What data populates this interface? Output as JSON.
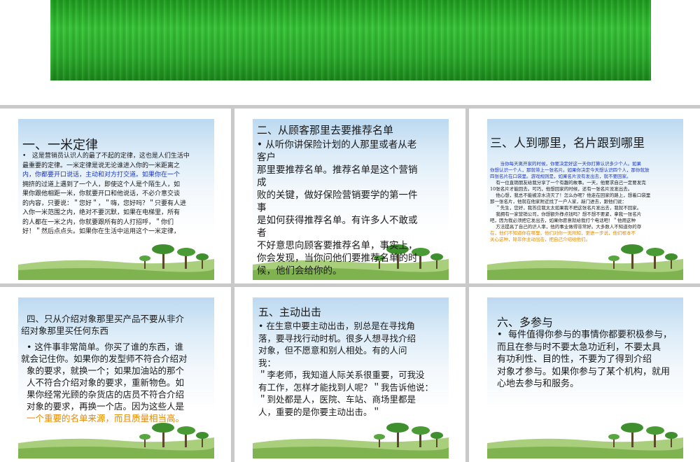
{
  "s1": {
    "title": "一、一米定律",
    "bullet": "•",
    "l1": "这是营销员认识人的最了不起的定律，这也是人们生活中",
    "l2": "最重要的定律。一米定律是说无论谁进入你的一米距离之",
    "l3": "内，你都要开口说话，主动和对方打交道。如果你在一个",
    "l4": "拥挤的过道上遇到了一个人，即使这个人是个陌生人，如",
    "l5": "果你跟他相距一米，你就要开口和他说话，不必介意交谈",
    "l6": "的内容，只要说：＂您好＂，＂嗨，您好吗？＂只要有人进",
    "l7": "入你一米范围之内，绝对不要沉默，如果在电梯里，所有",
    "l8": "的人都在一米之内，你就要跟所有的人打招呼，＂你们",
    "l9": "好！＂然后点点头。如果你在生活中运用这个一米定律，"
  },
  "s2": {
    "title": "二、从顾客那里去要推荐名单",
    "bullet": "•",
    "l1": "从听你讲保险计划的人那里或者从老客户",
    "l2": "那里要推荐名单。推荐名单是这个营销成",
    "l3": "败的关键，做好保险营销要学的第一件事",
    "l4": "是如何获得推荐名单。有许多人不敢或者",
    "l5": "不好意思向顾客要推荐名单，事实上，",
    "l6": "你会发现，当你问他们要推荐名单的时",
    "l7": "候，他们会给你的。"
  },
  "s3": {
    "title": "三、人到哪里，名片跟到哪里",
    "l1": "当你每天离开家的时候，你要决定好这一天你打算认识多少个人。如果",
    "l2": "你想认识一个人，那就带上一张名片。如果你决定今天想认识四个人，那你就放",
    "l3": "四张名片在口袋里。游戏规则是，如果名片没有发出去，就不要回家。",
    "l4": "有一位直销朋友给我分享了一个有趣的故事。一天，他要求自己一定要发完",
    "l5": "10张名片才能回去。可巧，他想回家的时候，还有一张名片没发出去。",
    "l6": "他心想，我总不能被凉水浇灭了！怎么办呢？他走在回家的路上，想着口袋里",
    "l7": "那一张名片，他就在他家附近找了一户人家，敲门进去，跟他们说：",
    "l8": "＂先生，您好，我答应我太太如果我不把这张名片发出去，我就不回家。",
    "l9": "我拥有一家营销公司，你想额外挣点钱吗？想不想不要紧，拿我一张名片",
    "l10": "吧，因为我必须把它发出去，如果你愿意就给我打个电话吧！＂他用这种",
    "l11": "方法提高了自己的识人率，他的事业做得非常好。大多数人不知道你的存",
    "l12": "在，他们不知道你在哪里，他们对你一无所知，更进一步说，他们根本不",
    "l13": "关心这种，除非你主动出击，把自己介绍给他们。"
  },
  "s4": {
    "title1": "四、只从介绍对象那里买产品不要从非介",
    "title2": "绍对象那里买任何东西",
    "bullet": "•",
    "l1": "这件事非常简单。你买了谁的东西，谁",
    "l2": "就会记住你。如果你的发型师不符合介绍对",
    "l3": "象的要求，就换一个；如果加油站的那个",
    "l4": "人不符合介绍对象的要求，重新物色。如",
    "l5": "果你经常光顾的杂货店的店员不符合介绍",
    "l6": "对象的要求，再换一个店。因为这些人是",
    "l7": "一个重要的名单来源，而且质量相当高。"
  },
  "s5": {
    "title": "五、主动出击",
    "bullet": "•",
    "l1": "在生意中要主动出击，别总是在寻找角",
    "l2": "落，要寻找行动时机。很多人想寻找介绍",
    "l3": "对象，但不愿意和别人相处。有的人问",
    "l4": "我：",
    "l5": "＂李老师，我知道人际关系很重要，可我没",
    "l6": "有工作，怎样才能找到人呢？＂我告诉他说：",
    "l7": "＂到处都是人，医院、车站、商场里都是",
    "l8": "人，重要的是你要主动出击。＂"
  },
  "s6": {
    "title": "六、多参与",
    "bullet": "•",
    "l1": "每件值得你参与的事情你都要积极参与，",
    "l2": "而且在参与时不要太急功近利，不要太具",
    "l3": "有功利性、目的性，不要为了得到介绍",
    "l4": "对象才参与。如果你参与了某个机构，就用",
    "l5": "心地去参与和服务。"
  }
}
